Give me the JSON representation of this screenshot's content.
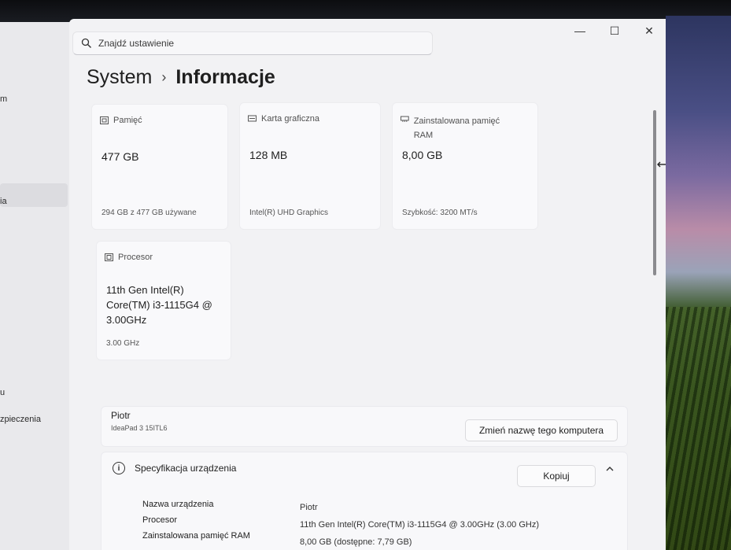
{
  "search": {
    "placeholder": "Znajdź ustawienie"
  },
  "breadcrumb": {
    "parent": "System",
    "separator": "›",
    "current": "Informacje"
  },
  "nav_fragments": [
    "m",
    "ia",
    "u",
    "zpieczenia"
  ],
  "cards": {
    "storage": {
      "label": "Pamięć",
      "value": "477 GB",
      "detail": "294 GB z 477 GB używane"
    },
    "gpu": {
      "label": "Karta graficzna",
      "value": "128 MB",
      "detail": "Intel(R) UHD Graphics"
    },
    "ram": {
      "label": "Zainstalowana pamięć RAM",
      "value": "8,00 GB",
      "detail": "Szybkość: 3200 MT/s"
    },
    "cpu": {
      "label": "Procesor",
      "value_lines": [
        "11th Gen Intel(R)",
        "Core(TM) i3-1115G4 @",
        "3.00GHz"
      ],
      "detail": "3.00 GHz"
    }
  },
  "device": {
    "name": "Piotr",
    "model": "IdeaPad 3 15ITL6",
    "rename_label": "Zmień nazwę tego komputera"
  },
  "spec": {
    "title": "Specyfikacja urządzenia",
    "copy_label": "Kopiuj",
    "rows": [
      {
        "key": "Nazwa urządzenia",
        "value": "Piotr"
      },
      {
        "key": "Procesor",
        "value": "11th Gen Intel(R) Core(TM) i3-1115G4 @ 3.00GHz (3.00 GHz)"
      },
      {
        "key": "Zainstalowana pamięć RAM",
        "value": "8,00 GB (dostępne: 7,79 GB)"
      }
    ]
  },
  "window_controls": {
    "minimize": "—",
    "maximize": "☐",
    "close": "✕"
  },
  "colors": {
    "window_bg": "#f2f2f4",
    "card_bg": "#f9f9fb"
  }
}
